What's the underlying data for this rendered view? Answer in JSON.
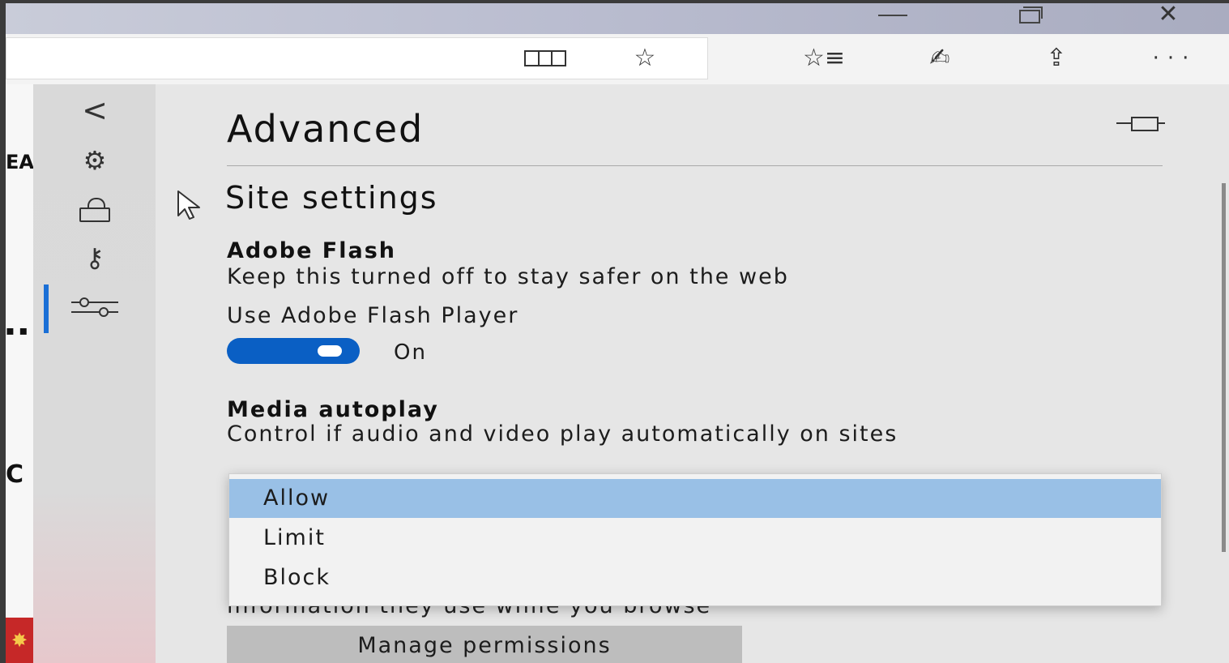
{
  "window": {
    "close_glyph": "✕"
  },
  "toolbar": {
    "favorite_glyph": "☆",
    "favorites_glyph": "☆≡",
    "notes_glyph": "✍",
    "share_glyph": "⇪",
    "more_glyph": "···"
  },
  "page_strip": {
    "text_top": "EA",
    "text_mid": "▪ ▪",
    "text_bottom": "C"
  },
  "rail": {
    "back_glyph": "<",
    "gear_glyph": "⚙",
    "key_glyph": "⚷",
    "active_item": "advanced"
  },
  "panel": {
    "title": "Advanced",
    "section": "Site settings",
    "flash": {
      "heading": "Adobe Flash",
      "description": "Keep this turned off to stay safer on the web",
      "toggle_label": "Use Adobe Flash Player",
      "toggle_state": "On"
    },
    "media": {
      "heading": "Media autoplay",
      "description": "Control if audio and video play automatically on sites",
      "options": [
        "Allow",
        "Limit",
        "Block"
      ],
      "selected": "Allow"
    },
    "obscured_text": "information they use while you browse",
    "manage_button": "Manage permissions"
  },
  "colors": {
    "accent": "#0a5fc4",
    "selected_option": "#99c0e6",
    "rail_indicator": "#1a6fd6"
  }
}
